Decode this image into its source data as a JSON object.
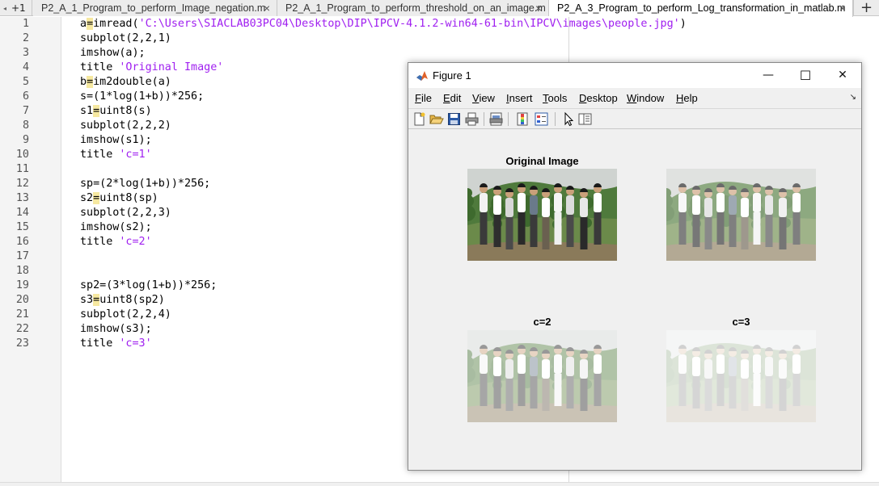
{
  "editor": {
    "tab_counter": "+1",
    "tabs": [
      {
        "label": "P2_A_1_Program_to_perform_Image_negation.m",
        "active": false
      },
      {
        "label": "P2_A_1_Program_to_perform_threshold_on_an_image.m",
        "active": false
      },
      {
        "label": "P2_A_3_Program_to_perform_Log_transformation_in_matlab.m",
        "active": true
      }
    ],
    "close_glyph": "×",
    "add_tab": "+",
    "lines": [
      {
        "num": "1",
        "segs": [
          {
            "t": "a",
            "c": ""
          },
          {
            "t": "=",
            "c": "hl"
          },
          {
            "t": "imread(",
            "c": ""
          },
          {
            "t": "'C:\\Users\\SIACLAB03PC04\\Desktop\\DIP\\IPCV-4.1.2-win64-61-bin\\IPCV\\images\\people.jpg'",
            "c": "str"
          },
          {
            "t": ")",
            "c": ""
          }
        ]
      },
      {
        "num": "2",
        "segs": [
          {
            "t": "subplot(2,2,1)",
            "c": ""
          }
        ]
      },
      {
        "num": "3",
        "segs": [
          {
            "t": "imshow(a);",
            "c": ""
          }
        ]
      },
      {
        "num": "4",
        "segs": [
          {
            "t": "title ",
            "c": ""
          },
          {
            "t": "'Original Image'",
            "c": "str"
          }
        ]
      },
      {
        "num": "5",
        "segs": [
          {
            "t": "b",
            "c": ""
          },
          {
            "t": "=",
            "c": "hl"
          },
          {
            "t": "im2double(a)",
            "c": ""
          }
        ]
      },
      {
        "num": "6",
        "segs": [
          {
            "t": "s=(1*log(1+b))*256;",
            "c": ""
          }
        ]
      },
      {
        "num": "7",
        "segs": [
          {
            "t": "s1",
            "c": ""
          },
          {
            "t": "=",
            "c": "hl"
          },
          {
            "t": "uint8(s)",
            "c": ""
          }
        ]
      },
      {
        "num": "8",
        "segs": [
          {
            "t": "subplot(2,2,2)",
            "c": ""
          }
        ]
      },
      {
        "num": "9",
        "segs": [
          {
            "t": "imshow(s1);",
            "c": ""
          }
        ]
      },
      {
        "num": "10",
        "segs": [
          {
            "t": "title ",
            "c": ""
          },
          {
            "t": "'c=1'",
            "c": "str"
          }
        ]
      },
      {
        "num": "11",
        "segs": []
      },
      {
        "num": "12",
        "segs": [
          {
            "t": "sp=(2*log(1+b))*256;",
            "c": ""
          }
        ]
      },
      {
        "num": "13",
        "segs": [
          {
            "t": "s2",
            "c": ""
          },
          {
            "t": "=",
            "c": "hl"
          },
          {
            "t": "uint8(sp)",
            "c": ""
          }
        ]
      },
      {
        "num": "14",
        "segs": [
          {
            "t": "subplot(2,2,3)",
            "c": ""
          }
        ]
      },
      {
        "num": "15",
        "segs": [
          {
            "t": "imshow(s2);",
            "c": ""
          }
        ]
      },
      {
        "num": "16",
        "segs": [
          {
            "t": "title ",
            "c": ""
          },
          {
            "t": "'c=2'",
            "c": "str"
          }
        ]
      },
      {
        "num": "17",
        "segs": []
      },
      {
        "num": "18",
        "segs": []
      },
      {
        "num": "19",
        "segs": [
          {
            "t": "sp2=(3*log(1+b))*256;",
            "c": ""
          }
        ]
      },
      {
        "num": "20",
        "segs": [
          {
            "t": "s3",
            "c": ""
          },
          {
            "t": "=",
            "c": "hl"
          },
          {
            "t": "uint8(sp2)",
            "c": ""
          }
        ]
      },
      {
        "num": "21",
        "segs": [
          {
            "t": "subplot(2,2,4)",
            "c": ""
          }
        ]
      },
      {
        "num": "22",
        "segs": [
          {
            "t": "imshow(s3);",
            "c": ""
          }
        ]
      },
      {
        "num": "23",
        "segs": [
          {
            "t": "title ",
            "c": ""
          },
          {
            "t": "'c=3'",
            "c": "str"
          }
        ]
      }
    ]
  },
  "figure": {
    "title": "Figure 1",
    "window_buttons": {
      "minimize": "—",
      "maximize": "☐",
      "close": "✕"
    },
    "menu": [
      {
        "label": "File",
        "underline": 0
      },
      {
        "label": "Edit",
        "underline": 0
      },
      {
        "label": "View",
        "underline": 0
      },
      {
        "label": "Insert",
        "underline": 0
      },
      {
        "label": "Tools",
        "underline": 0
      },
      {
        "label": "Desktop",
        "underline": 0
      },
      {
        "label": "Window",
        "underline": 0
      },
      {
        "label": "Help",
        "underline": 0
      }
    ],
    "dock_glyph": "↘",
    "toolbar": [
      "new-figure-icon",
      "open-file-icon",
      "save-icon",
      "print-icon",
      "print-preview-icon",
      "colorbar-icon",
      "legend-icon",
      "pointer-icon",
      "property-inspector-icon"
    ],
    "axes": [
      {
        "title": "Original Image",
        "brightness": "original"
      },
      {
        "title": "",
        "brightness": "light"
      },
      {
        "title": "c=2",
        "brightness": "bright"
      },
      {
        "title": "c=3",
        "brightness": "washed"
      }
    ],
    "axes_toolbar": [
      "brush-icon",
      "datatip-icon",
      "pan-icon",
      "zoom-in-icon",
      "zoom-out-icon",
      "home-icon"
    ]
  },
  "colors": {
    "string": "#a020f0",
    "highlight": "#f6e8a0",
    "line_number": "#555555"
  }
}
